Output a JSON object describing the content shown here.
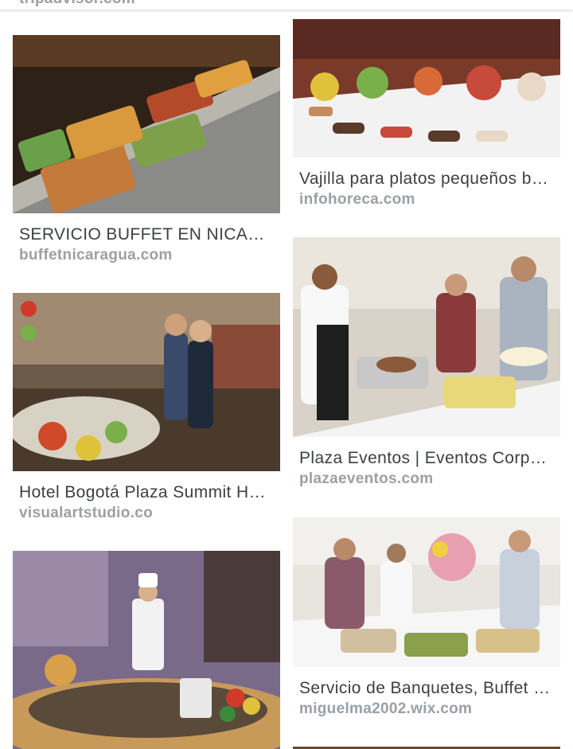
{
  "top_partial": {
    "source": "tripadvisor.com"
  },
  "left_column": [
    {
      "title": "SERVICIO BUFFET EN NICARAGUA",
      "source": "buffetnicaragua.com"
    },
    {
      "title": "Hotel Bogotá Plaza Summit Hotel",
      "source": "visualartstudio.co"
    },
    {
      "title": "",
      "source": ""
    }
  ],
  "right_column": [
    {
      "title": "Vajilla para platos pequeños buffet",
      "source": "infohoreca.com"
    },
    {
      "title": "Plaza Eventos | Eventos Corporativos",
      "source": "plazaeventos.com"
    },
    {
      "title": "Servicio de Banquetes, Buffet y Catering",
      "source": "miguelma2002.wix.com"
    }
  ]
}
